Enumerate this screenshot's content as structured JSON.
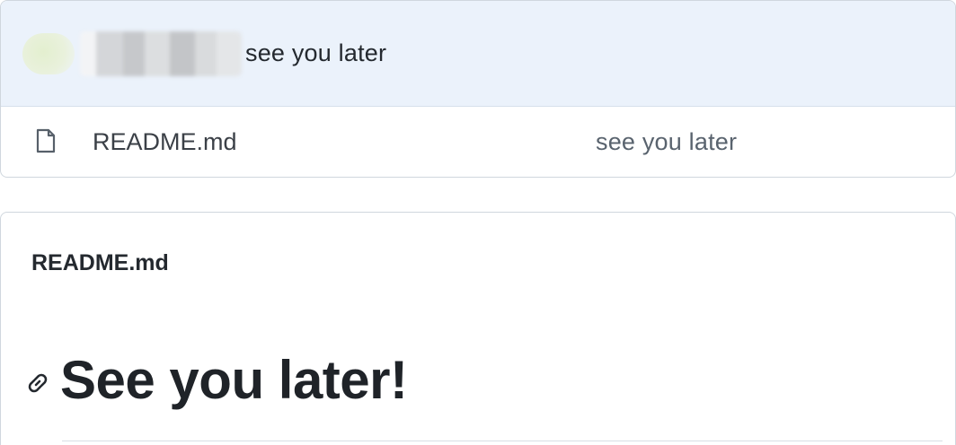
{
  "latest_commit": {
    "author": "",
    "message": "see you later"
  },
  "files": [
    {
      "name": "README.md",
      "commit_message": "see you later",
      "icon": "file-icon"
    }
  ],
  "readme": {
    "title": "README.md",
    "heading": "See you later!",
    "anchor_icon": "link-icon"
  },
  "colors": {
    "commit_header_bg": "#ebf2fb",
    "border": "#d0d7de",
    "text": "#24292f",
    "muted": "#59636e"
  }
}
